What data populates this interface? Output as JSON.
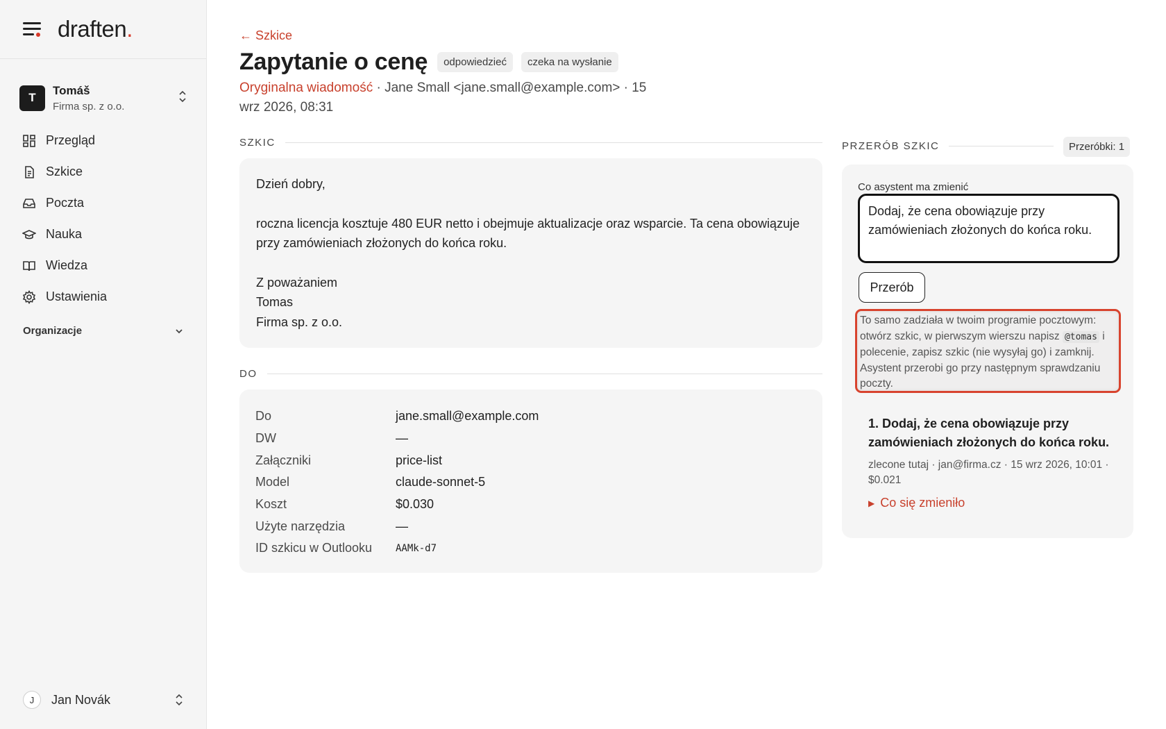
{
  "brand": {
    "name": "draften",
    "dot": "."
  },
  "org": {
    "initial": "T",
    "name": "Tomáš",
    "company": "Firma sp. z o.o."
  },
  "nav": [
    {
      "label": "Przegląd",
      "icon": "dashboard-icon"
    },
    {
      "label": "Szkice",
      "icon": "document-icon"
    },
    {
      "label": "Poczta",
      "icon": "inbox-icon"
    },
    {
      "label": "Nauka",
      "icon": "graduation-cap-icon"
    },
    {
      "label": "Wiedza",
      "icon": "book-icon"
    },
    {
      "label": "Ustawienia",
      "icon": "gear-icon"
    }
  ],
  "org_section": {
    "label": "Organizacje"
  },
  "user": {
    "initial": "J",
    "name": "Jan Novák"
  },
  "header": {
    "back": "← Szkice",
    "title": "Zapytanie o cenę",
    "badges": [
      "odpowiedzieć",
      "czeka na wysłanie"
    ],
    "original_link": "Oryginalna wiadomość",
    "meta_rest": " · Jane Small <jane.small@example.com> · 15 wrz 2026, 08:31"
  },
  "draft": {
    "section": "SZKIC",
    "greeting": "Dzień dobry,",
    "body": "roczna licencja kosztuje 480 EUR netto i obejmuje aktualizacje oraz wsparcie. Ta cena obowiązuje przy zamówieniach złożonych do końca roku.",
    "closing": "Z poważaniem",
    "signature_name": "Tomas",
    "signature_company": "Firma sp. z o.o."
  },
  "to": {
    "section": "DO",
    "rows": [
      {
        "k": "Do",
        "v": "jane.small@example.com"
      },
      {
        "k": "DW",
        "v": "—"
      },
      {
        "k": "Załączniki",
        "v": "price-list"
      },
      {
        "k": "Model",
        "v": "claude-sonnet-5"
      },
      {
        "k": "Koszt",
        "v": "$0.030"
      },
      {
        "k": "Użyte narzędzia",
        "v": "—"
      },
      {
        "k": "ID szkicu w Outlooku",
        "v": "AAMk-d7"
      }
    ]
  },
  "revise": {
    "section": "PRZERÓB SZKIC",
    "count": "Przeróbki: 1",
    "field_label": "Co asystent ma zmienić",
    "field_value": "Dodaj, że cena obowiązuje przy zamówieniach złożonych do końca roku.",
    "button": "Przerób",
    "hint_before": "To samo zadziała w twoim programie pocztowym: otwórz szkic, w pierwszym wierszu napisz ",
    "hint_code": "@tomas",
    "hint_after": " i polecenie, zapisz szkic (nie wysyłaj go) i zamknij. Asystent przerobi go przy następnym sprawdzaniu poczty.",
    "history_title": "1. Dodaj, że cena obowiązuje przy zamówieniach złożonych do końca roku.",
    "history_meta": "zlecone tutaj · jan@firma.cz · 15 wrz 2026, 10:01 · $0.021",
    "history_toggle": "Co się zmieniło"
  },
  "colors": {
    "accent": "#c8412d",
    "sidebar_bg": "#f5f5f5",
    "card_bg": "#f5f5f5"
  }
}
